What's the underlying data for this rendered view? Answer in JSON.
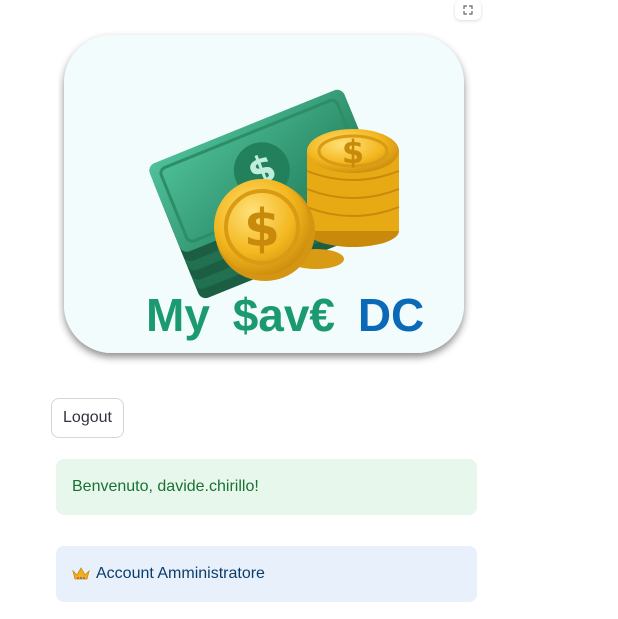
{
  "toolbar": {
    "fullscreen_icon": "fullscreen-expand-icon"
  },
  "logo": {
    "brand_part1": "My",
    "brand_part2": "$av€",
    "brand_part3": "DC",
    "colors": {
      "green_text": "#1a9a6e",
      "blue_text": "#0b6ab8",
      "bill_green": "#2f9a73",
      "coin_gold": "#f1b51e",
      "card_bg": "#f3fcfc"
    }
  },
  "actions": {
    "logout_label": "Logout"
  },
  "messages": {
    "success_text": "Benvenuto, davide.chirillo!",
    "info_text": "Account Amministratore",
    "info_icon": "crown-icon",
    "colors": {
      "success_bg": "#e8f7ec",
      "success_fg": "#177233",
      "info_bg": "#e8f1fb",
      "info_fg": "#0b3d6b"
    }
  }
}
